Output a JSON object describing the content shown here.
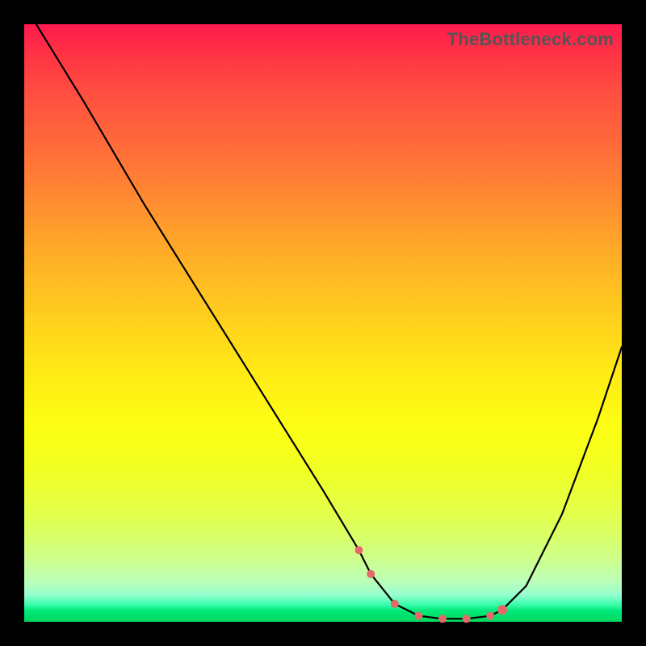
{
  "watermark": "TheBottleneck.com",
  "chart_data": {
    "type": "line",
    "title": "",
    "xlabel": "",
    "ylabel": "",
    "xlim": [
      0,
      100
    ],
    "ylim": [
      0,
      100
    ],
    "x": [
      2,
      10,
      20,
      30,
      40,
      50,
      56,
      58,
      62,
      66,
      70,
      74,
      78,
      80,
      84,
      90,
      96,
      100
    ],
    "values": [
      100,
      87,
      70,
      54,
      38,
      22,
      12,
      8,
      3,
      1,
      0.5,
      0.5,
      1,
      2,
      6,
      18,
      34,
      46
    ],
    "series_name": "bottleneck",
    "markers": {
      "x": [
        56,
        58,
        62,
        66,
        70,
        74,
        78,
        80
      ],
      "values": [
        12,
        8,
        3,
        1,
        0.5,
        0.5,
        1,
        2
      ]
    },
    "gradient_bg": true
  }
}
